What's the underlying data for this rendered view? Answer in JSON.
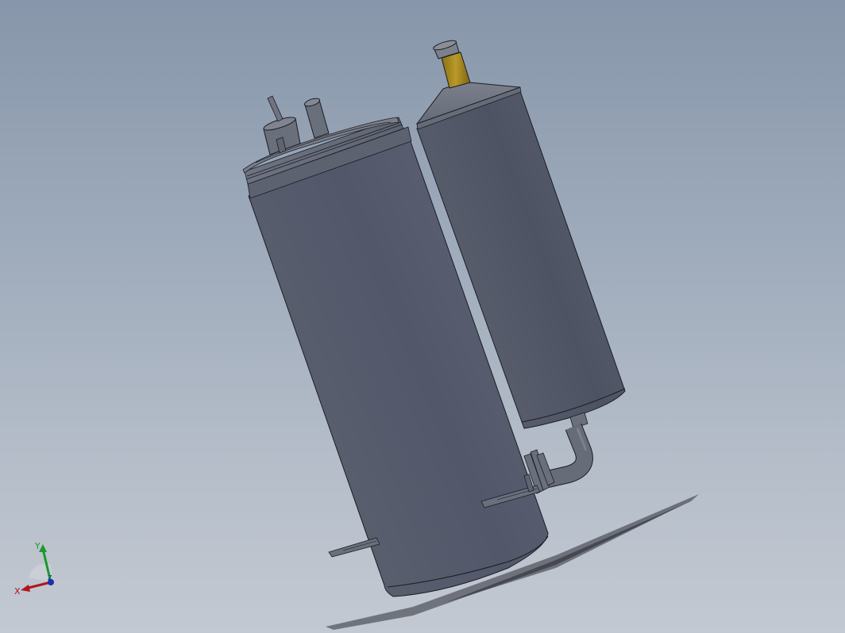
{
  "triad": {
    "x_label": "X",
    "y_label": "Y",
    "z_label": "Z"
  },
  "colors": {
    "background_top": "#8796aa",
    "background_bottom": "#c3c9d2",
    "body_metal": "#585e6d",
    "edge_line": "#1a1d24",
    "brass_fitting": "#a88a1e",
    "axis_x": "#b3141a",
    "axis_y": "#1d9a2c",
    "axis_z": "#1a2fb0"
  },
  "icons": {
    "view_triad": "reference-triad-icon"
  }
}
